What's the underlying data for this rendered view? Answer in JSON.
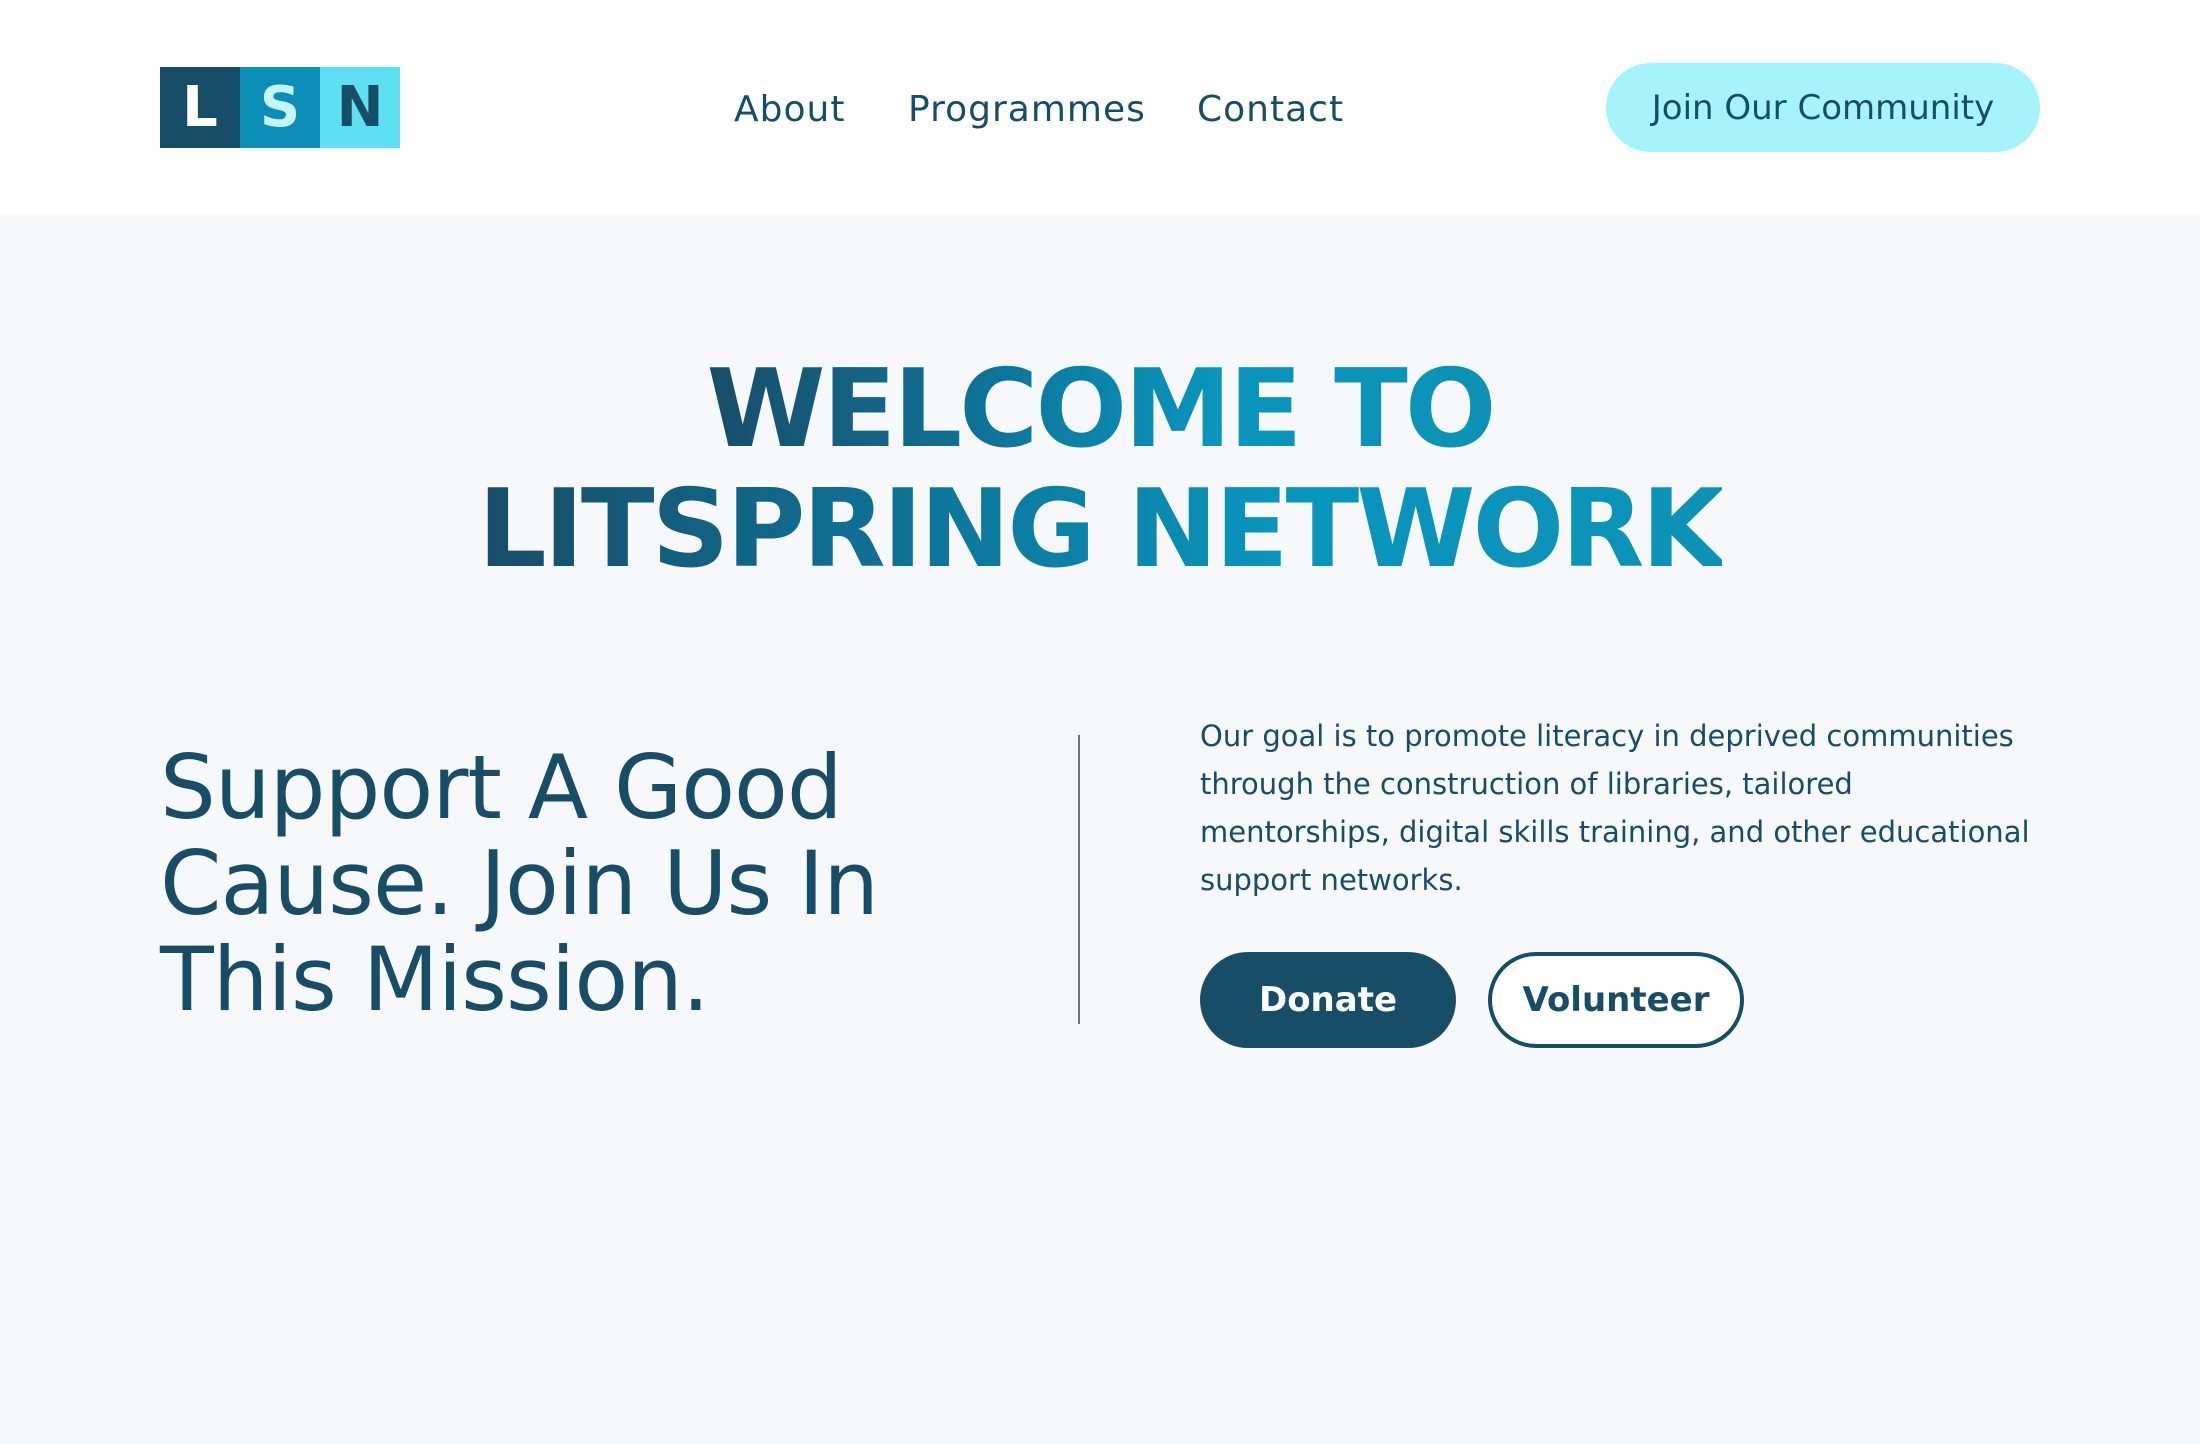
{
  "header": {
    "logo": {
      "letters": [
        "L",
        "S",
        "N"
      ],
      "colors": [
        "#184d68",
        "#0b8fb8",
        "#5ee0f3"
      ]
    },
    "nav": [
      {
        "label": "About"
      },
      {
        "label": "Programmes"
      },
      {
        "label": "Contact"
      }
    ],
    "cta_label": "Join Our Community"
  },
  "hero": {
    "title_line1": "WELCOME TO",
    "title_line2": "LITSPRING NETWORK",
    "tagline": "Support A Good Cause. Join Us In This Mission.",
    "description": "Our goal is to promote literacy in deprived communities through the construction of libraries, tailored mentorships, digital skills training, and other educational support networks.",
    "donate_label": "Donate",
    "volunteer_label": "Volunteer"
  },
  "colors": {
    "primary": "#184d68",
    "accent": "#0b8fb8",
    "light_accent": "#a6f3fb",
    "background": "#f7f8fa"
  }
}
